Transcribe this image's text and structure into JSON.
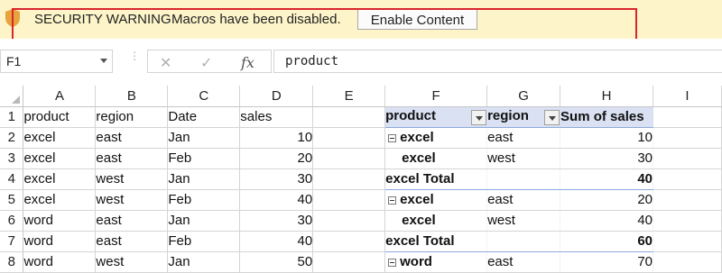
{
  "message_bar": {
    "title": "SECURITY WARNING",
    "text": "Macros have been disabled.",
    "button": "Enable Content",
    "highlight_color": "#d9252d"
  },
  "formula_bar": {
    "name_box": "F1",
    "formula": "product",
    "icons": [
      "cancel-icon",
      "enter-icon",
      "fx-icon"
    ]
  },
  "columns": [
    "A",
    "B",
    "C",
    "D",
    "E",
    "F",
    "G",
    "H",
    "I"
  ],
  "rows": [
    {
      "n": "1",
      "a": "product",
      "b": "region",
      "c": "Date",
      "d": "sales",
      "f": "product",
      "g": "region",
      "h": "Sum of sales",
      "type": "header"
    },
    {
      "n": "2",
      "a": "excel",
      "b": "east",
      "c": "Jan",
      "d": "10",
      "f": "excel",
      "g": "east",
      "h": "10",
      "type": "group"
    },
    {
      "n": "3",
      "a": "excel",
      "b": "east",
      "c": "Feb",
      "d": "20",
      "f": "excel",
      "g": "west",
      "h": "30",
      "type": "item"
    },
    {
      "n": "4",
      "a": "excel",
      "b": "west",
      "c": "Jan",
      "d": "30",
      "f": "excel Total",
      "g": "",
      "h": "40",
      "type": "total"
    },
    {
      "n": "5",
      "a": "excel",
      "b": "west",
      "c": "Feb",
      "d": "40",
      "f": "excel",
      "g": "east",
      "h": "20",
      "type": "group"
    },
    {
      "n": "6",
      "a": "word",
      "b": "east",
      "c": "Jan",
      "d": "30",
      "f": "excel",
      "g": "west",
      "h": "40",
      "type": "item"
    },
    {
      "n": "7",
      "a": "word",
      "b": "east",
      "c": "Feb",
      "d": "40",
      "f": "excel  Total",
      "g": "",
      "h": "60",
      "type": "total"
    },
    {
      "n": "8",
      "a": "word",
      "b": "west",
      "c": "Jan",
      "d": "50",
      "f": "word",
      "g": "east",
      "h": "70",
      "type": "group"
    }
  ]
}
